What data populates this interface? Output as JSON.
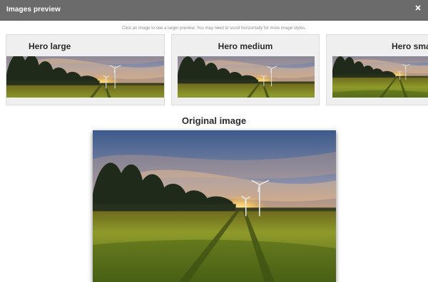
{
  "dialog": {
    "title": "Images preview",
    "close_icon": "close-icon",
    "hint": "Click an image to see a larger preview. You may need to scroll horizontally for more image styles."
  },
  "styles": [
    {
      "label": "Hero large"
    },
    {
      "label": "Hero medium"
    },
    {
      "label": "Hero small"
    }
  ],
  "original": {
    "label": "Original image"
  },
  "colors": {
    "titlebar": "#6b6b6b",
    "card_bg": "#efefef",
    "sky_top": "#3d5a8c",
    "sunset": "#f6b04a",
    "field": "#8a9b2a"
  }
}
